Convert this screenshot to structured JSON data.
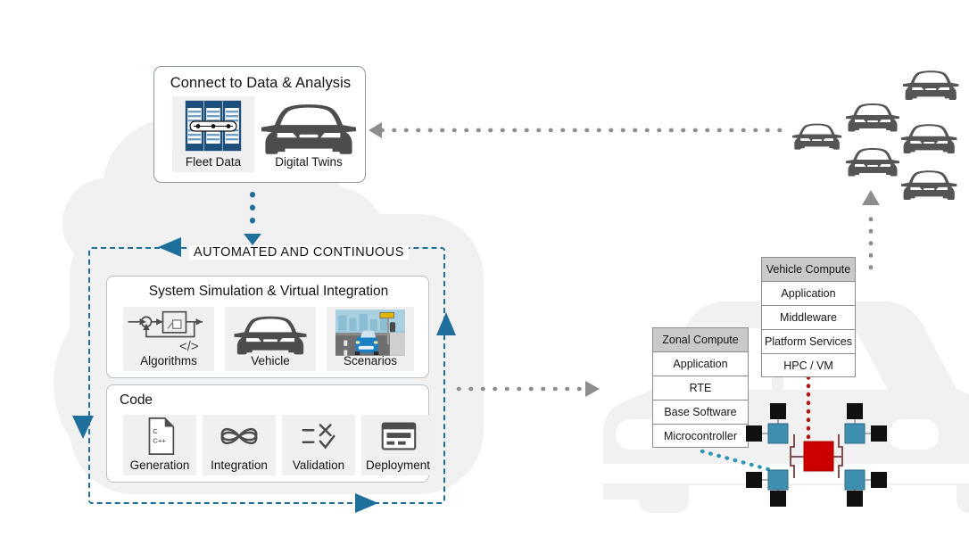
{
  "diagram": {
    "title_hidden": "Software Defined Vehicle Development Workflow",
    "colors": {
      "accent_blue": "#1f6f9c",
      "arrow_gray": "#8d8d8d",
      "node_teal": "#3e8fb0",
      "node_red": "#cc0000",
      "node_black": "#111111",
      "panel_border": "#8e9aa3",
      "tile_bg": "#f0f0f0",
      "stack_header_bg": "#c9c9c9",
      "background_shape": "#f0f0f0"
    }
  },
  "connect_panel": {
    "title": "Connect to Data & Analysis",
    "tiles": [
      {
        "label": "Fleet Data",
        "icon": "server-rack-icon"
      },
      {
        "label": "Digital Twins",
        "icon": "car-front-icon"
      }
    ]
  },
  "automated_box": {
    "label": "AUTOMATED AND CONTINUOUS",
    "sections": [
      {
        "title": "System Simulation & Virtual Integration",
        "tiles": [
          {
            "label": "Algorithms",
            "icon": "block-diagram-code-icon"
          },
          {
            "label": "Vehicle",
            "icon": "car-front-icon"
          },
          {
            "label": "Scenarios",
            "icon": "driving-scene-icon"
          }
        ]
      },
      {
        "title": "Code",
        "tiles": [
          {
            "label": "Generation",
            "icon": "c-cpp-document-icon"
          },
          {
            "label": "Integration",
            "icon": "interlocking-knot-icon"
          },
          {
            "label": "Validation",
            "icon": "checklist-x-check-icon"
          },
          {
            "label": "Deployment",
            "icon": "deploy-window-icon"
          }
        ]
      }
    ]
  },
  "vehicle_compute_stack": {
    "header": "Vehicle Compute",
    "rows": [
      "Application",
      "Middleware",
      "Platform Services",
      "HPC / VM"
    ]
  },
  "zonal_compute_stack": {
    "header": "Zonal Compute",
    "rows": [
      "Application",
      "RTE",
      "Base Software",
      "Microcontroller"
    ]
  },
  "network": {
    "central_node": "central-gateway",
    "teal_nodes": 4,
    "black_nodes": 8,
    "links": {
      "vehicle_compute_to_gateway": "red-dotted",
      "zonal_compute_to_node": "teal-dotted"
    }
  },
  "fleet": {
    "icon": "car-front-icon",
    "count": 6
  },
  "arrows": [
    {
      "name": "fleet-to-connect-arrow",
      "direction": "left",
      "style": "gray-dotted"
    },
    {
      "name": "connect-to-automated-arrow",
      "direction": "down",
      "style": "blue-dotted"
    },
    {
      "name": "automated-left-arrow",
      "direction": "left",
      "style": "blue-solid"
    },
    {
      "name": "automated-down-arrow",
      "direction": "down",
      "style": "blue-solid"
    },
    {
      "name": "automated-right-arrow",
      "direction": "right",
      "style": "blue-solid"
    },
    {
      "name": "automated-up-arrow",
      "direction": "up",
      "style": "blue-solid"
    },
    {
      "name": "code-to-vehicle-arrow",
      "direction": "right",
      "style": "gray-dotted"
    },
    {
      "name": "vehicle-to-fleet-arrow",
      "direction": "up",
      "style": "gray-dotted"
    }
  ]
}
